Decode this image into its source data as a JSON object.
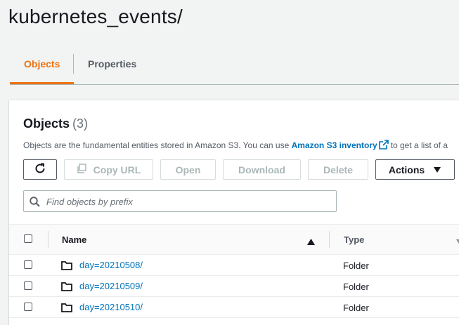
{
  "page": {
    "title": "kubernetes_events/"
  },
  "tabs": [
    {
      "label": "Objects",
      "active": true
    },
    {
      "label": "Properties",
      "active": false
    }
  ],
  "panel": {
    "heading": "Objects",
    "count": "(3)",
    "description_prefix": "Objects are the fundamental entities stored in Amazon S3. You can use",
    "inventory_link": "Amazon S3 inventory",
    "description_suffix": "to get a list of a"
  },
  "toolbar": {
    "refresh_icon": "refresh-icon",
    "copy_url_label": "Copy URL",
    "open_label": "Open",
    "download_label": "Download",
    "delete_label": "Delete",
    "actions_label": "Actions"
  },
  "search": {
    "placeholder": "Find objects by prefix",
    "value": ""
  },
  "table": {
    "columns": [
      "Name",
      "Type"
    ],
    "sort": "ascending",
    "rows": [
      {
        "name": "day=20210508/",
        "type": "Folder"
      },
      {
        "name": "day=20210509/",
        "type": "Folder"
      },
      {
        "name": "day=20210510/",
        "type": "Folder"
      }
    ]
  },
  "colors": {
    "accent": "#ec7211",
    "link": "#0073bb",
    "text": "#16191f",
    "muted": "#545b64",
    "background": "#f2f3f3"
  }
}
